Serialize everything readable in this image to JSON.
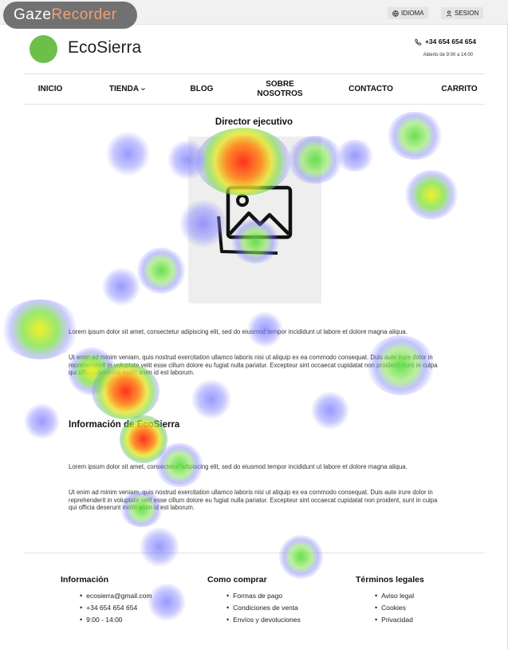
{
  "watermark": {
    "part1": "Gaze",
    "part2": "Recorder"
  },
  "topbar": {
    "language_label": "IDIOMA",
    "login_label": "SESION"
  },
  "header": {
    "brand": "EcoSierra",
    "phone": "+34 654 654 654",
    "hours": "Abierto de 9:00 a 14:00",
    "logo_color": "#6cc04a"
  },
  "nav": {
    "items": [
      {
        "label": "INICIO"
      },
      {
        "label": "TIENDA"
      },
      {
        "label": "BLOG"
      },
      {
        "label": "SOBRE NOSOTROS"
      },
      {
        "label": "CONTACTO"
      },
      {
        "label": "CARRITO"
      }
    ]
  },
  "director": {
    "title": "Director ejecutivo",
    "image_icon": "image-placeholder-icon",
    "para1": "Lorem ipsum dolor sit amet, consectetur adipiscing elit, sed do eiusmod tempor incididunt ut labore et dolore magna aliqua.",
    "para2": "Ut enim ad minim veniam, quis nostrud exercitation ullamco laboris nisi ut aliquip ex ea commodo consequat. Duis aute irure dolor in reprehenderit in voluptate velit esse cillum dolore eu fugiat nulla pariatur. Excepteur sint occaecat cupidatat non proident, sunt in culpa qui officia deserunt mollit anim id est laborum."
  },
  "info": {
    "title": "Información de EcoSierra",
    "para1": "Lorem ipsum dolor sit amet, consectetur adipiscing elit, sed do eiusmod tempor incididunt ut labore et dolore magna aliqua.",
    "para2": "Ut enim ad minim veniam, quis nostrud exercitation ullamco laboris nisi ut aliquip ex ea commodo consequat. Duis aute irure dolor in reprehenderit in voluptate velit esse cillum dolore eu fugiat nulla pariatur. Excepteur sint occaecat cupidatat non proident, sunt in culpa qui officia deserunt mollit anim id est laborum."
  },
  "footer": {
    "columns": [
      {
        "heading": "Información",
        "items": [
          "ecosierra@gmail.com",
          "+34 654 654 654",
          "9:00 - 14:00"
        ]
      },
      {
        "heading": "Como comprar",
        "items": [
          "Formas de pago",
          "Condiciones de venta",
          "Envíos y devoluciones"
        ]
      },
      {
        "heading": "Términos legales",
        "items": [
          "Aviso legal",
          "Cookies",
          "Privacidad"
        ]
      }
    ]
  }
}
